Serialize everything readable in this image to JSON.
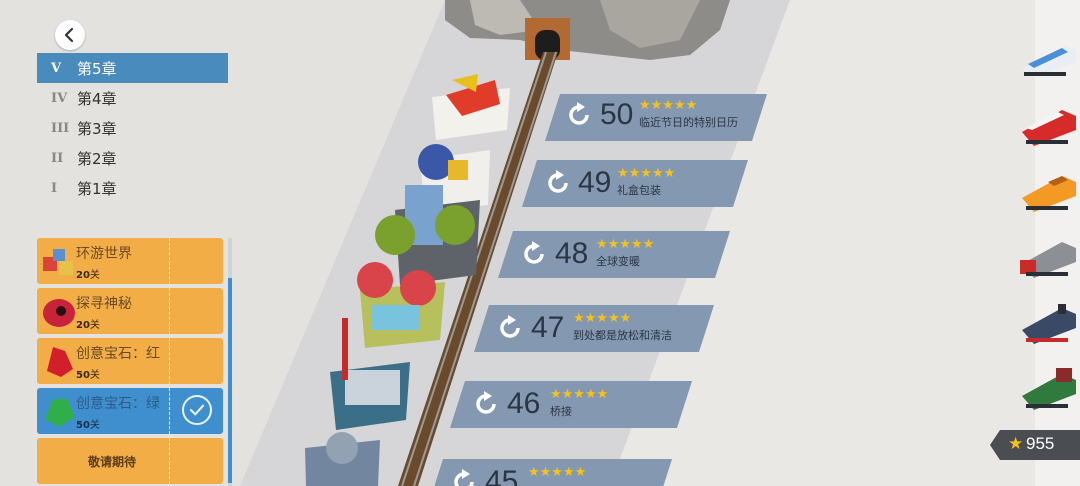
{
  "chapters": [
    {
      "roman": "V",
      "label": "第5章",
      "active": true
    },
    {
      "roman": "IV",
      "label": "第4章",
      "active": false
    },
    {
      "roman": "III",
      "label": "第3章",
      "active": false
    },
    {
      "roman": "II",
      "label": "第2章",
      "active": false
    },
    {
      "roman": "I",
      "label": "第1章",
      "active": false
    }
  ],
  "packs": [
    {
      "title": "环游世界",
      "count": "20",
      "unit": "关",
      "state": "locked"
    },
    {
      "title": "探寻神秘",
      "count": "20",
      "unit": "关",
      "state": "locked"
    },
    {
      "title": "创意宝石：红",
      "count": "50",
      "unit": "关",
      "state": "locked"
    },
    {
      "title": "创意宝石：绿",
      "count": "50",
      "unit": "关",
      "state": "done"
    },
    {
      "title": "敬请期待",
      "state": "soon"
    }
  ],
  "levels": [
    {
      "number": "50",
      "stars": "★★★★★",
      "name": "临近节日的特别日历"
    },
    {
      "number": "49",
      "stars": "★★★★★",
      "name": "礼盒包装"
    },
    {
      "number": "48",
      "stars": "★★★★★",
      "name": "全球变暖"
    },
    {
      "number": "47",
      "stars": "★★★★★",
      "name": "到处都是放松和清洁"
    },
    {
      "number": "46",
      "stars": "★★★★★",
      "name": "桥接"
    },
    {
      "number": "45",
      "stars": "★★★★★",
      "name": ""
    }
  ],
  "trains": [
    "bullet-train-icon",
    "red-diesel-train-icon",
    "orange-diesel-train-icon",
    "red-grey-loco-icon",
    "blue-steam-loco-icon",
    "green-steam-loco-icon"
  ],
  "star_total": "955",
  "colors": {
    "accent": "#4a8bbd",
    "pack": "#f2ad47",
    "pack_done": "#3f8fcf",
    "banner": "#8498b1",
    "star": "#f4c21b"
  }
}
